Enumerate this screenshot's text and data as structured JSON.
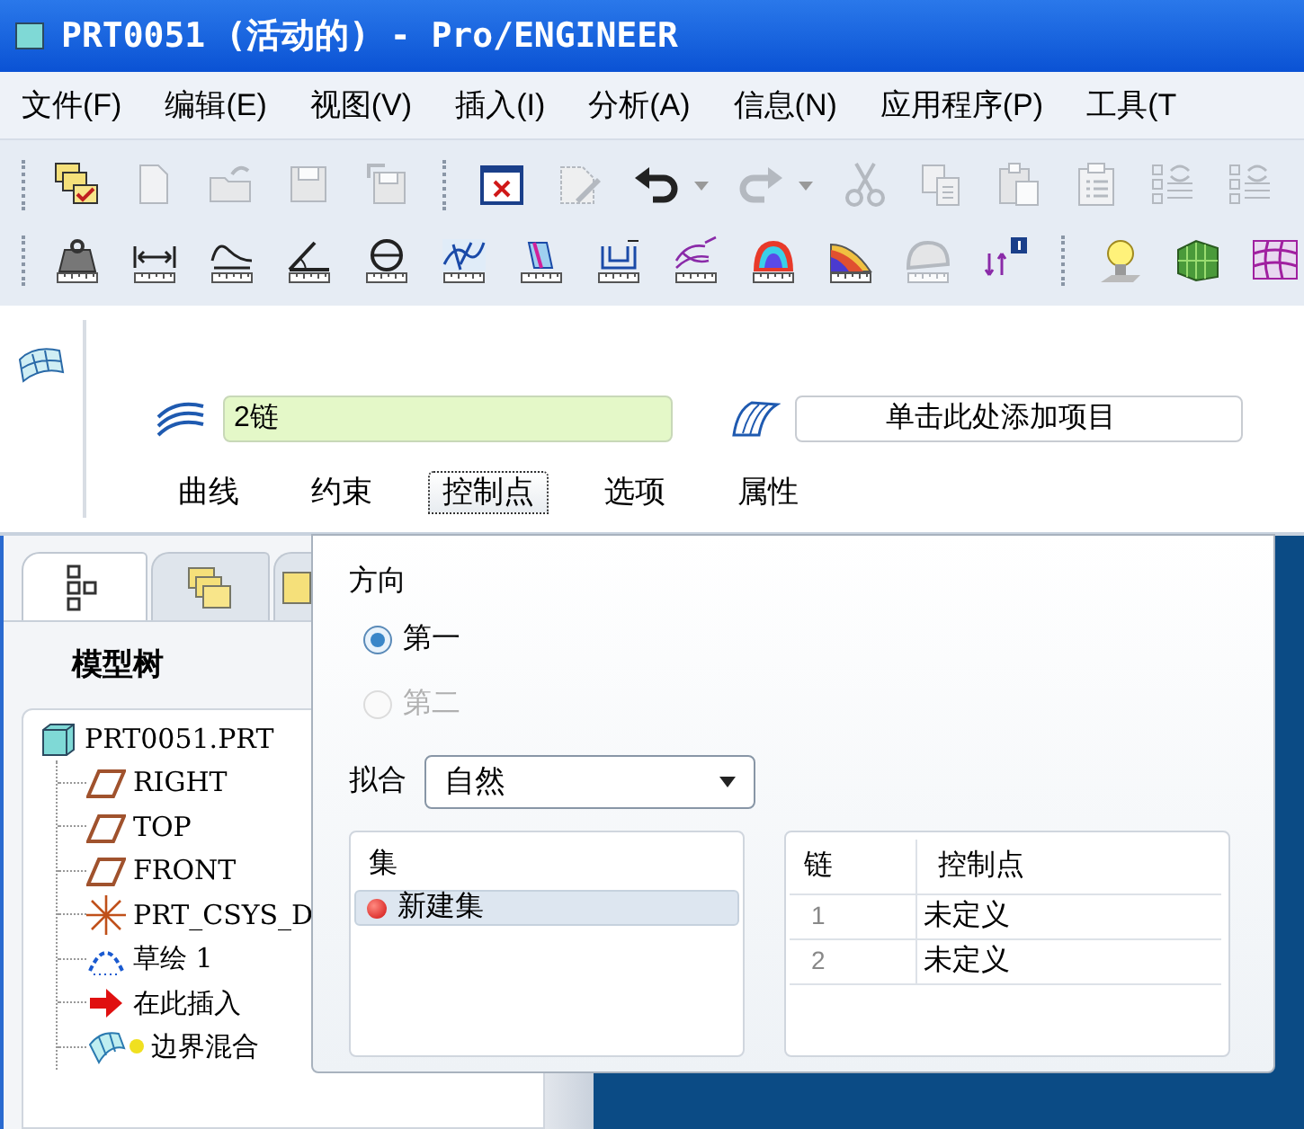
{
  "window": {
    "title": "PRT0051 (活动的) - Pro/ENGINEER"
  },
  "menu": [
    "文件(F)",
    "编辑(E)",
    "视图(V)",
    "插入(I)",
    "分析(A)",
    "信息(N)",
    "应用程序(P)",
    "工具(T"
  ],
  "toolbar": {
    "rows": [
      [
        {
          "kind": "folder",
          "disabled": false
        },
        {
          "kind": "doc",
          "disabled": true
        },
        {
          "kind": "open",
          "disabled": true
        },
        {
          "kind": "save",
          "disabled": true
        },
        {
          "kind": "saveas",
          "disabled": true
        },
        {
          "kind": "separator"
        },
        {
          "kind": "closewin",
          "disabled": false
        },
        {
          "kind": "regen",
          "disabled": true
        },
        {
          "kind": "undo",
          "disabled": false,
          "dropdown": true
        },
        {
          "kind": "redo",
          "disabled": true,
          "dropdown": true
        },
        {
          "kind": "cut",
          "disabled": true
        },
        {
          "kind": "copy",
          "disabled": true
        },
        {
          "kind": "paste",
          "disabled": true
        },
        {
          "kind": "pastespecial",
          "disabled": true
        },
        {
          "kind": "list",
          "disabled": true
        },
        {
          "kind": "list",
          "disabled": true
        }
      ],
      [
        {
          "kind": "weight",
          "disabled": false
        },
        {
          "kind": "distance",
          "disabled": false
        },
        {
          "kind": "length",
          "disabled": false
        },
        {
          "kind": "angle",
          "disabled": false
        },
        {
          "kind": "diameter",
          "disabled": false
        },
        {
          "kind": "curve",
          "disabled": false
        },
        {
          "kind": "section",
          "disabled": false
        },
        {
          "kind": "offset",
          "disabled": false
        },
        {
          "kind": "mesh",
          "disabled": false
        },
        {
          "kind": "colorsurface",
          "disabled": false
        },
        {
          "kind": "shaded",
          "disabled": false
        },
        {
          "kind": "surface",
          "disabled": true
        },
        {
          "kind": "info",
          "disabled": false
        },
        {
          "kind": "separator"
        },
        {
          "kind": "bulb",
          "disabled": false
        },
        {
          "kind": "greensurface",
          "disabled": false
        },
        {
          "kind": "grid",
          "disabled": false
        }
      ]
    ]
  },
  "dashboard": {
    "first_chain": {
      "value": "2链"
    },
    "second_chain": {
      "placeholder": "单击此处添加项目"
    },
    "tabs": [
      {
        "label": "曲线",
        "selected": false
      },
      {
        "label": "约束",
        "selected": false
      },
      {
        "label": "控制点",
        "selected": true
      },
      {
        "label": "选项",
        "selected": false
      },
      {
        "label": "属性",
        "selected": false
      }
    ]
  },
  "control_points_panel": {
    "direction_label": "方向",
    "directions": [
      {
        "label": "第一",
        "selected": true,
        "disabled": false
      },
      {
        "label": "第二",
        "selected": false,
        "disabled": true
      }
    ],
    "fit_label": "拟合",
    "fit": {
      "value": "自然"
    },
    "sets": {
      "header": "集",
      "items": [
        {
          "label": "新建集",
          "selected": true
        }
      ]
    },
    "table": {
      "columns": [
        "链",
        "控制点"
      ],
      "rows": [
        [
          "1",
          "未定义"
        ],
        [
          "2",
          "未定义"
        ]
      ]
    }
  },
  "model_tree": {
    "tabs": [
      {
        "kind": "tree",
        "selected": true
      },
      {
        "kind": "folders",
        "selected": false
      },
      {
        "kind": "folder",
        "selected": false
      }
    ],
    "title": "模型树",
    "root": {
      "label": "PRT0051.PRT",
      "kind": "part",
      "children": [
        {
          "label": "RIGHT",
          "kind": "plane"
        },
        {
          "label": "TOP",
          "kind": "plane"
        },
        {
          "label": "FRONT",
          "kind": "plane"
        },
        {
          "label": "PRT_CSYS_D",
          "kind": "csys"
        },
        {
          "label": "草绘 1",
          "kind": "sketch"
        },
        {
          "label": "在此插入",
          "kind": "insert"
        },
        {
          "label": "边界混合",
          "kind": "blend"
        }
      ]
    }
  }
}
